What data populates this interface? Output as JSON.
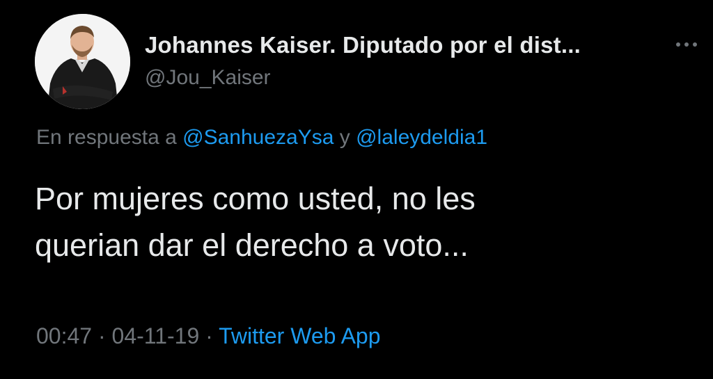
{
  "author": {
    "display_name": "Johannes Kaiser. Diputado por el dist...",
    "handle": "@Jou_Kaiser"
  },
  "reply": {
    "prefix": "En respuesta a",
    "mention_1": "@SanhuezaYsa",
    "conjunction": "y",
    "mention_2": "@laleydeldia1"
  },
  "tweet": {
    "line_1": "Por mujeres como usted, no les",
    "line_2": "querian dar el derecho a voto..."
  },
  "meta": {
    "time": "00:47",
    "separator_1": "·",
    "date": "04-11-19",
    "separator_2": "·",
    "source": "Twitter Web App"
  },
  "icons": {
    "more": "more-horizontal-icon"
  },
  "colors": {
    "background": "#000000",
    "primary_text": "#e7e9ea",
    "secondary_text": "#71767b",
    "link": "#1d9bf0"
  }
}
